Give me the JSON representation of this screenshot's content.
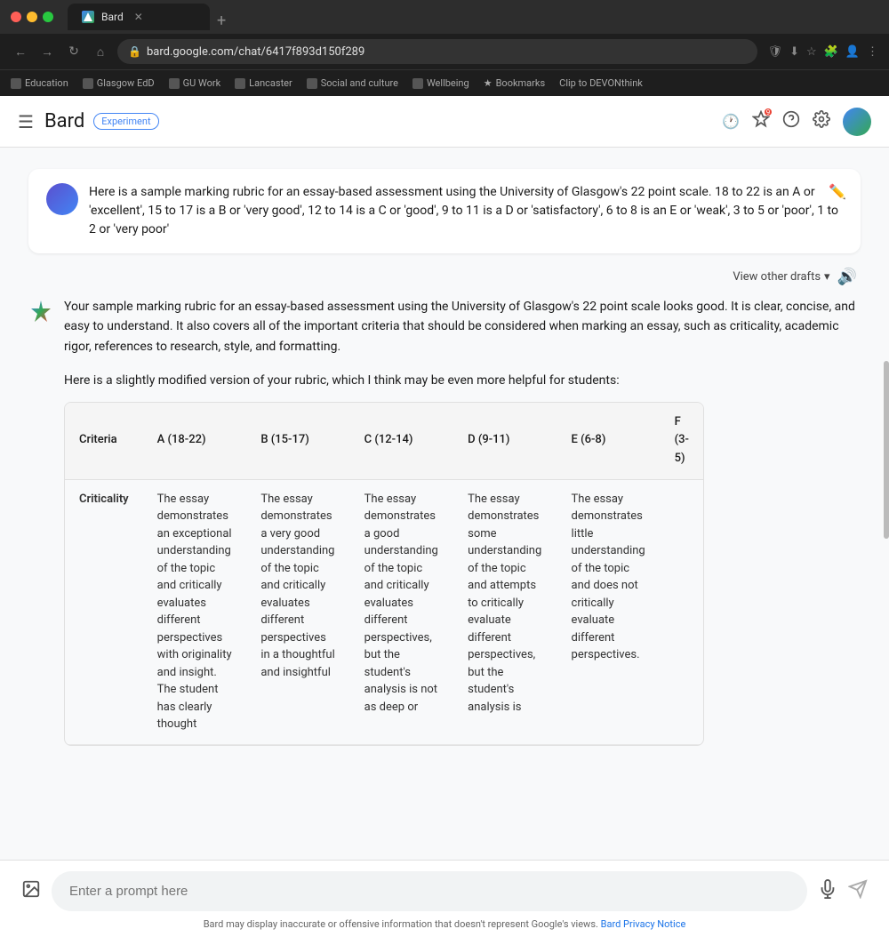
{
  "browser": {
    "tab": {
      "title": "Bard",
      "favicon_label": "bard-favicon",
      "close_label": "✕"
    },
    "new_tab_label": "+",
    "url": "bard.google.com/chat/6417f893d150f289",
    "nav": {
      "back": "←",
      "forward": "→",
      "reload": "↻",
      "home": "⌂"
    },
    "bookmarks": [
      "Education",
      "Glasgow EdD",
      "GU Work",
      "Lancaster",
      "Social and culture",
      "Wellbeing",
      "Bookmarks",
      "Clip to DEVONthink"
    ]
  },
  "app": {
    "title": "Bard",
    "badge": "Experiment",
    "header_icons": {
      "history": "🕐",
      "star": "✦",
      "help": "?",
      "settings": "⚙"
    }
  },
  "conversation": {
    "user_message": "Here is a sample marking rubric for an essay-based assessment using the University of Glasgow's 22 point scale. 18 to 22 is an A or 'excellent', 15 to 17 is a B or 'very good', 12 to 14 is a C or 'good', 9 to 11 is a D or 'satisfactory', 6 to 8 is an E or 'weak', 3 to 5 or 'poor', 1 to 2 or 'very poor'",
    "view_drafts_label": "View other drafts",
    "response_intro": "Your sample marking rubric for an essay-based assessment using the University of Glasgow's 22 point scale looks good. It is clear, concise, and easy to understand. It also covers all of the important criteria that should be considered when marking an essay, such as criticality, academic rigor, references to research, style, and formatting.",
    "response_subtitle": "Here is a slightly modified version of your rubric, which I think may be even more helpful for students:",
    "table": {
      "headers": [
        "Criteria",
        "A (18-22)",
        "B (15-17)",
        "C (12-14)",
        "D (9-11)",
        "E (6-8)",
        "F (3-5)"
      ],
      "rows": [
        {
          "criteria": "Criticality",
          "a": "The essay demonstrates an exceptional understanding of the topic and critically evaluates different perspectives with originality and insight. The student has clearly thought",
          "b": "The essay demonstrates a very good understanding of the topic and critically evaluates different perspectives in a thoughtful and insightful",
          "c": "The essay demonstrates a good understanding of the topic and critically evaluates different perspectives, but the student's analysis is not as deep or",
          "d": "The essay demonstrates some understanding of the topic and attempts to critically evaluate different perspectives, but the student's analysis is",
          "e": "The essay demonstrates little understanding of the topic and does not critically evaluate different perspectives.",
          "f": ""
        }
      ]
    }
  },
  "input": {
    "placeholder": "Enter a prompt here",
    "disclaimer": "Bard may display inaccurate or offensive information that doesn't represent Google's views.",
    "disclaimer_link": "Bard Privacy Notice"
  }
}
